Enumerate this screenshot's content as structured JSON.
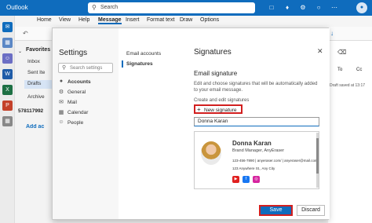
{
  "app": {
    "title": "Outlook",
    "search_placeholder": "Search",
    "avatar_initial": ""
  },
  "ribbon": {
    "tabs": [
      "Home",
      "View",
      "Help",
      "Message",
      "Insert",
      "Format text",
      "Draw",
      "Options"
    ],
    "active_tab": "Message"
  },
  "folders": {
    "favorites": "Favorites",
    "items": [
      "Inbox",
      "Sent Ite",
      "Drafts",
      "Archive"
    ],
    "selected": "Drafts",
    "account": "578117992",
    "add_account": "Add ac"
  },
  "right_pane": {
    "to_label": "To",
    "cc_label": "Cc",
    "draft_note": "Draft saved at 13:17"
  },
  "settings": {
    "title": "Settings",
    "search_placeholder": "Search settings",
    "nav": [
      {
        "label": "Accounts",
        "icon": "person-icon"
      },
      {
        "label": "General",
        "icon": "gear-icon"
      },
      {
        "label": "Mail",
        "icon": "mail-icon"
      },
      {
        "label": "Calendar",
        "icon": "calendar-icon"
      },
      {
        "label": "People",
        "icon": "people-icon"
      }
    ],
    "subnav": [
      "Email accounts",
      "Signatures"
    ]
  },
  "signatures": {
    "title": "Signatures",
    "section_title": "Email signature",
    "description": "Edit and choose signatures that will be automatically added to your email message.",
    "create_label": "Create and edit signatures",
    "new_signature": "New signature",
    "name_value": "Donna Karan",
    "signature": {
      "name": "Donna Karan",
      "role": "Brand Manager, AnyEraser",
      "contacts": "123-456-7890  |  anyeraser.com/  |  anyeraser@mail.com",
      "address": "123 Anywhere St., Any City"
    },
    "save": "Save",
    "discard": "Discard"
  },
  "colors": {
    "accent": "#0f6cbd",
    "highlight": "#d21f1f"
  }
}
